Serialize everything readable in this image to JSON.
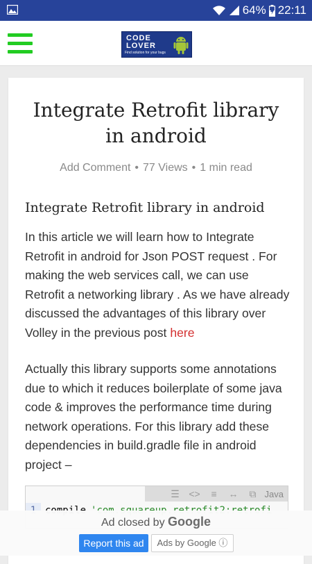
{
  "status_bar": {
    "battery": "64%",
    "time": "22:11",
    "icons": [
      "image-icon",
      "wifi-icon",
      "signal-icon",
      "battery-icon"
    ]
  },
  "header": {
    "menu_icon": "hamburger-menu-icon",
    "logo_line1": "CODE",
    "logo_line2": "LOVER",
    "logo_tagline": "Find solution for your bugs",
    "accent_color": "#22cc22"
  },
  "article": {
    "title": "Integrate Retrofit library in android",
    "meta": {
      "comment": "Add Comment",
      "views": "77 Views",
      "read_time": "1 min read"
    },
    "subheading": "Integrate Retrofit library in android",
    "para1": "In this article we will learn how to Integrate Retrofit in android for Json POST request . For making the web services call, we can use Retrofit a networking library . As we have already discussed the advantages of this library over Volley in the previous post",
    "para1_link": "here",
    "para2": "Actually this library supports some annotations due to which it reduces boilerplate of some java code & improves the performance time during network operations. For this library add these dependencies in build.gradle file in android project –",
    "code": {
      "language": "Java",
      "line_number": "1",
      "keyword": "compile",
      "string": "'com.squareup.retrofit2:retrofi"
    }
  },
  "ad": {
    "closed_text": "Ad closed by",
    "closed_brand": "Google",
    "report_label": "Report this ad",
    "ads_by_label": "Ads by Google ⓘ",
    "report_color": "#2f86ef"
  }
}
